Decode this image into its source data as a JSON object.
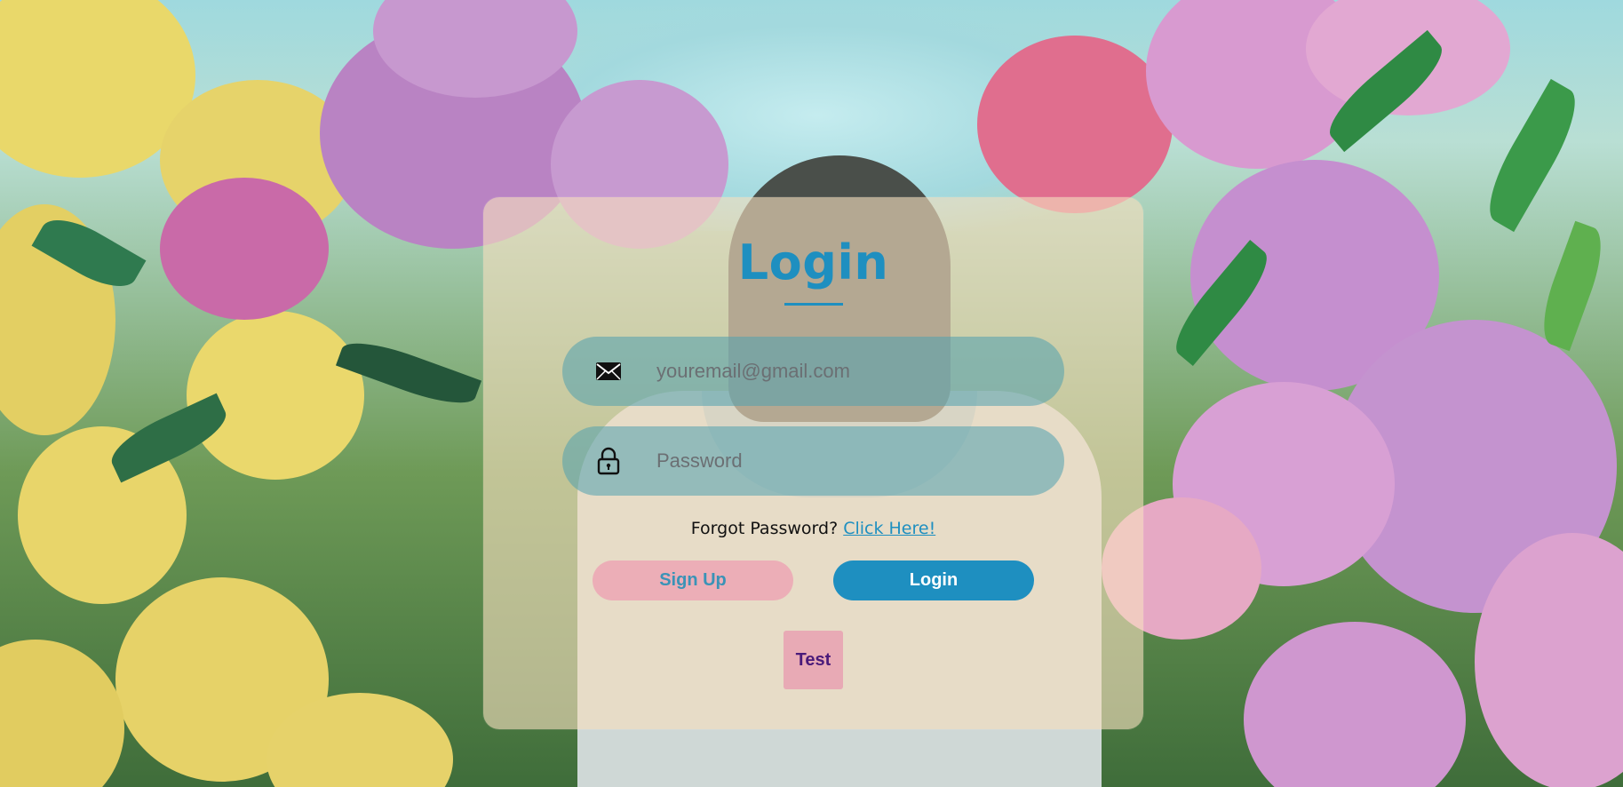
{
  "page": {
    "title": "Login"
  },
  "form": {
    "email": {
      "placeholder": "youremail@gmail.com",
      "value": "",
      "icon": "envelope-icon"
    },
    "password": {
      "placeholder": "Password",
      "value": "",
      "icon": "lock-icon"
    },
    "forgot_text": "Forgot Password?",
    "forgot_link": "Click Here!",
    "signup_label": "Sign Up",
    "login_label": "Login",
    "test_label": "Test"
  },
  "colors": {
    "accent": "#1e8fc0",
    "card": "#f5debe",
    "signup_bg": "#eca6b4",
    "test_bg": "#e8aab5",
    "test_text": "#4a1a7a"
  }
}
